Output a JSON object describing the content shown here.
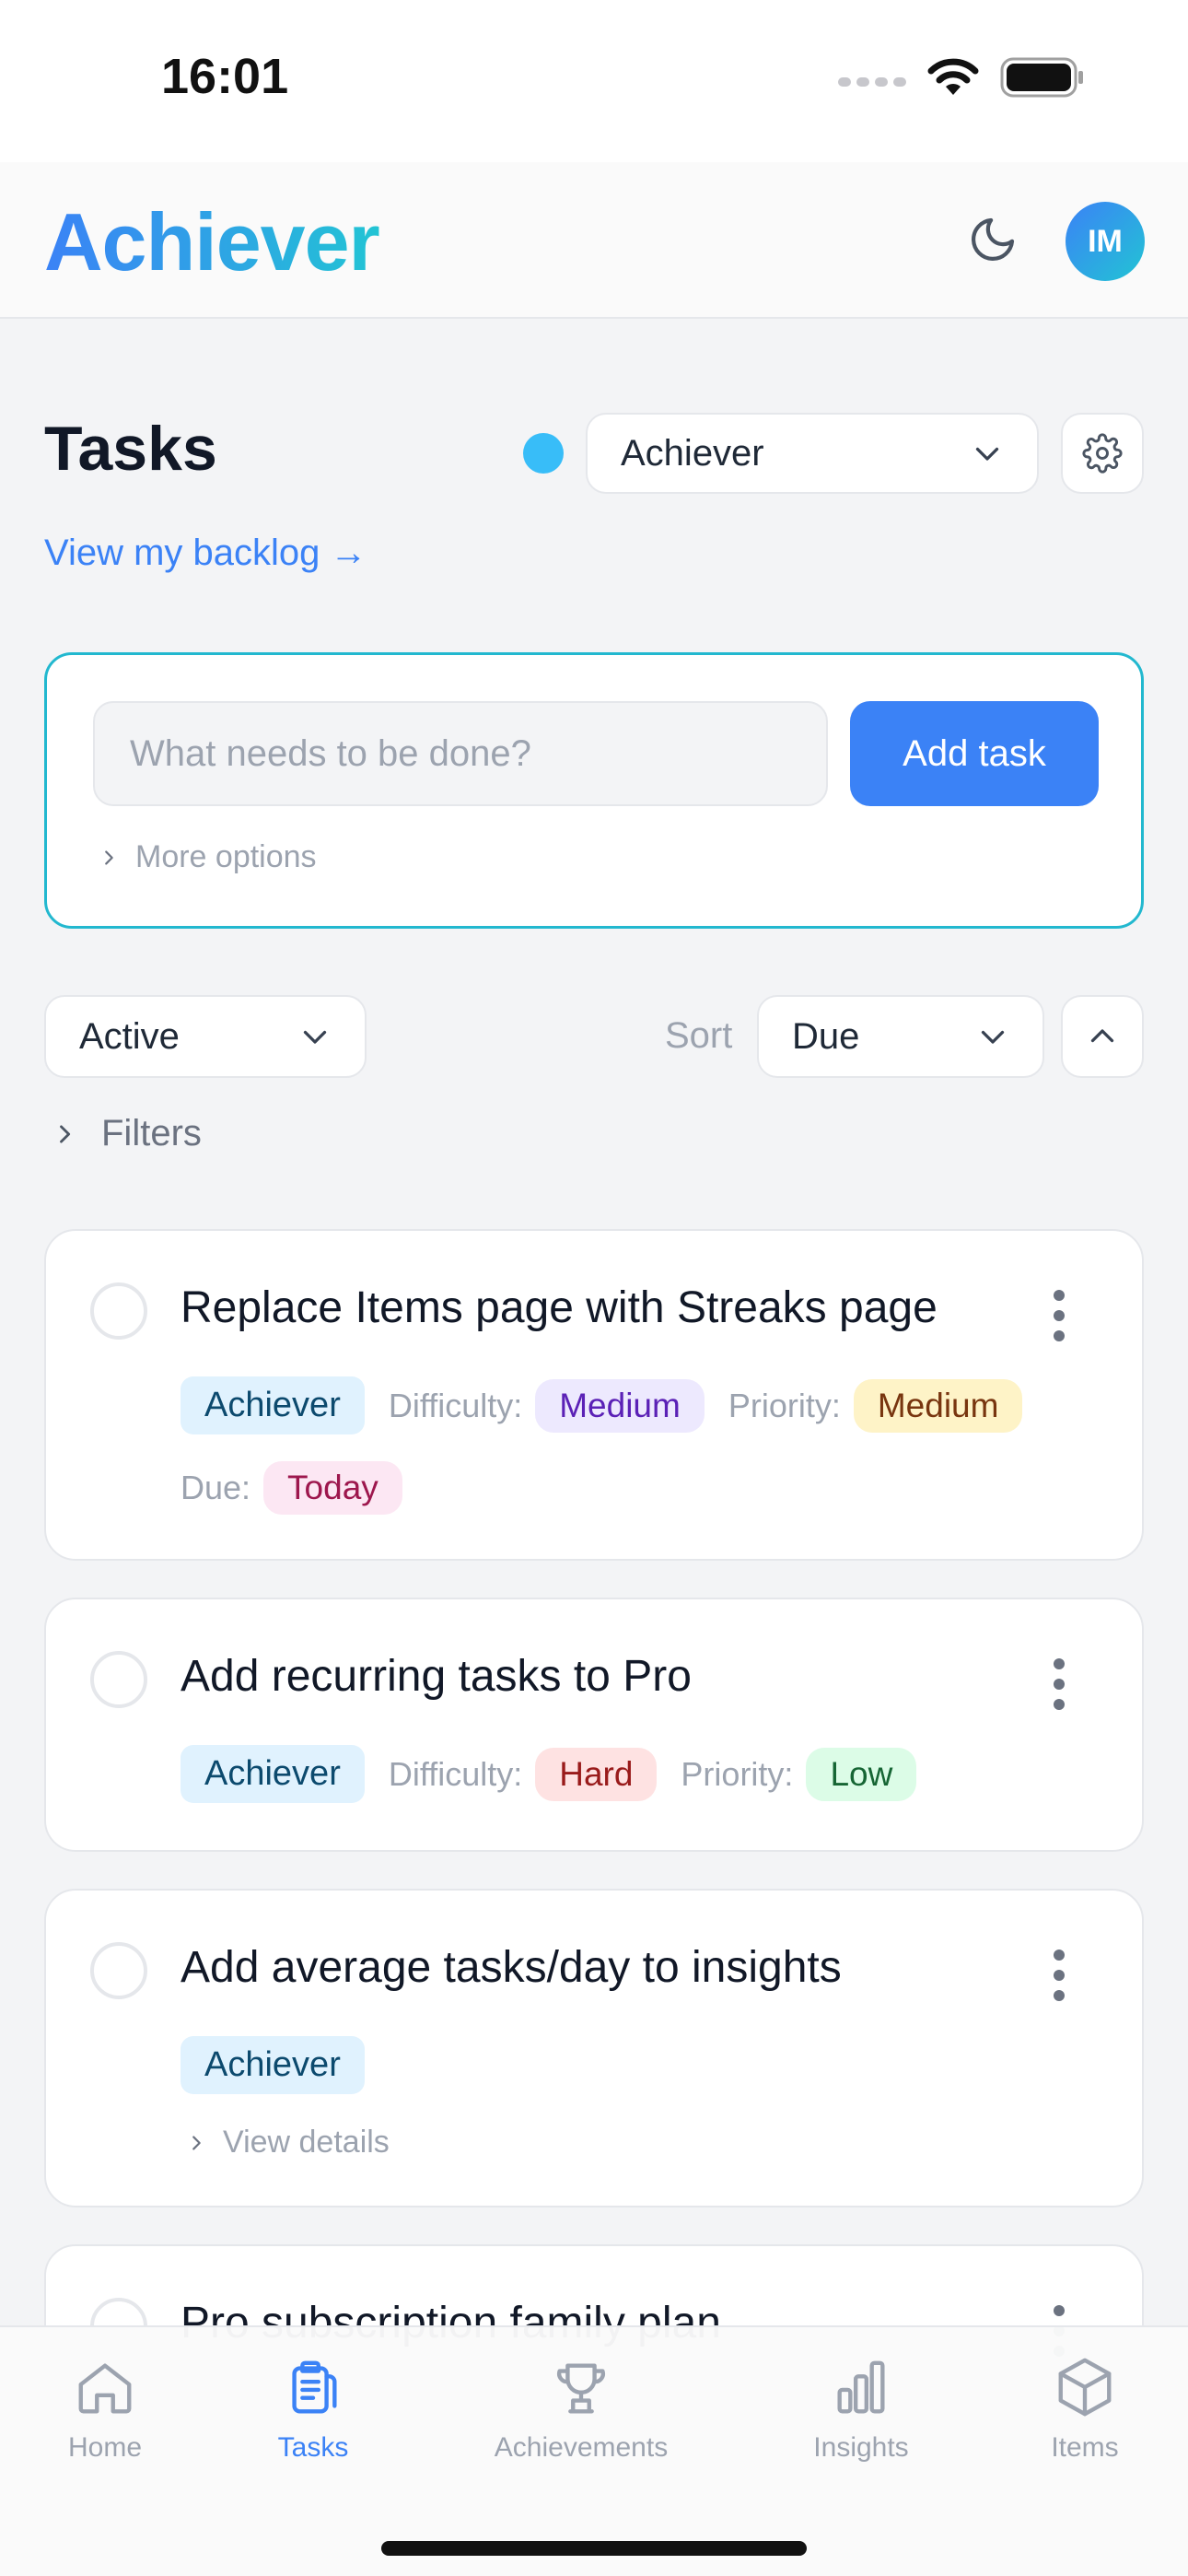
{
  "status_bar": {
    "time": "16:01"
  },
  "header": {
    "brand": "Achiever",
    "avatar_initials": "IM"
  },
  "page": {
    "title": "Tasks",
    "project_select": "Achiever",
    "backlog_link": "View my backlog →"
  },
  "add_task": {
    "placeholder": "What needs to be done?",
    "button": "Add task",
    "more_options": "More options"
  },
  "controls": {
    "status_filter": "Active",
    "sort_label": "Sort",
    "sort_value": "Due",
    "filters_label": "Filters"
  },
  "labels": {
    "difficulty": "Difficulty:",
    "priority": "Priority:",
    "due": "Due:",
    "view_details": "View details"
  },
  "tasks": [
    {
      "title": "Replace Items page with Streaks page",
      "project": "Achiever",
      "difficulty": "Medium",
      "priority": "Medium",
      "due": "Today"
    },
    {
      "title": "Add recurring tasks to Pro",
      "project": "Achiever",
      "difficulty": "Hard",
      "priority": "Low"
    },
    {
      "title": "Add average tasks/day to insights",
      "project": "Achiever"
    },
    {
      "title": "Pro subscription family plan"
    }
  ],
  "nav": [
    {
      "label": "Home",
      "icon": "home-icon"
    },
    {
      "label": "Tasks",
      "icon": "clipboard-icon",
      "active": true
    },
    {
      "label": "Achievements",
      "icon": "trophy-icon"
    },
    {
      "label": "Insights",
      "icon": "bar-chart-icon"
    },
    {
      "label": "Items",
      "icon": "cube-icon"
    }
  ],
  "colors": {
    "accent": "#3b82f6",
    "brand_gradient_end": "#22c4d4",
    "project_dot": "#38bdf8"
  }
}
